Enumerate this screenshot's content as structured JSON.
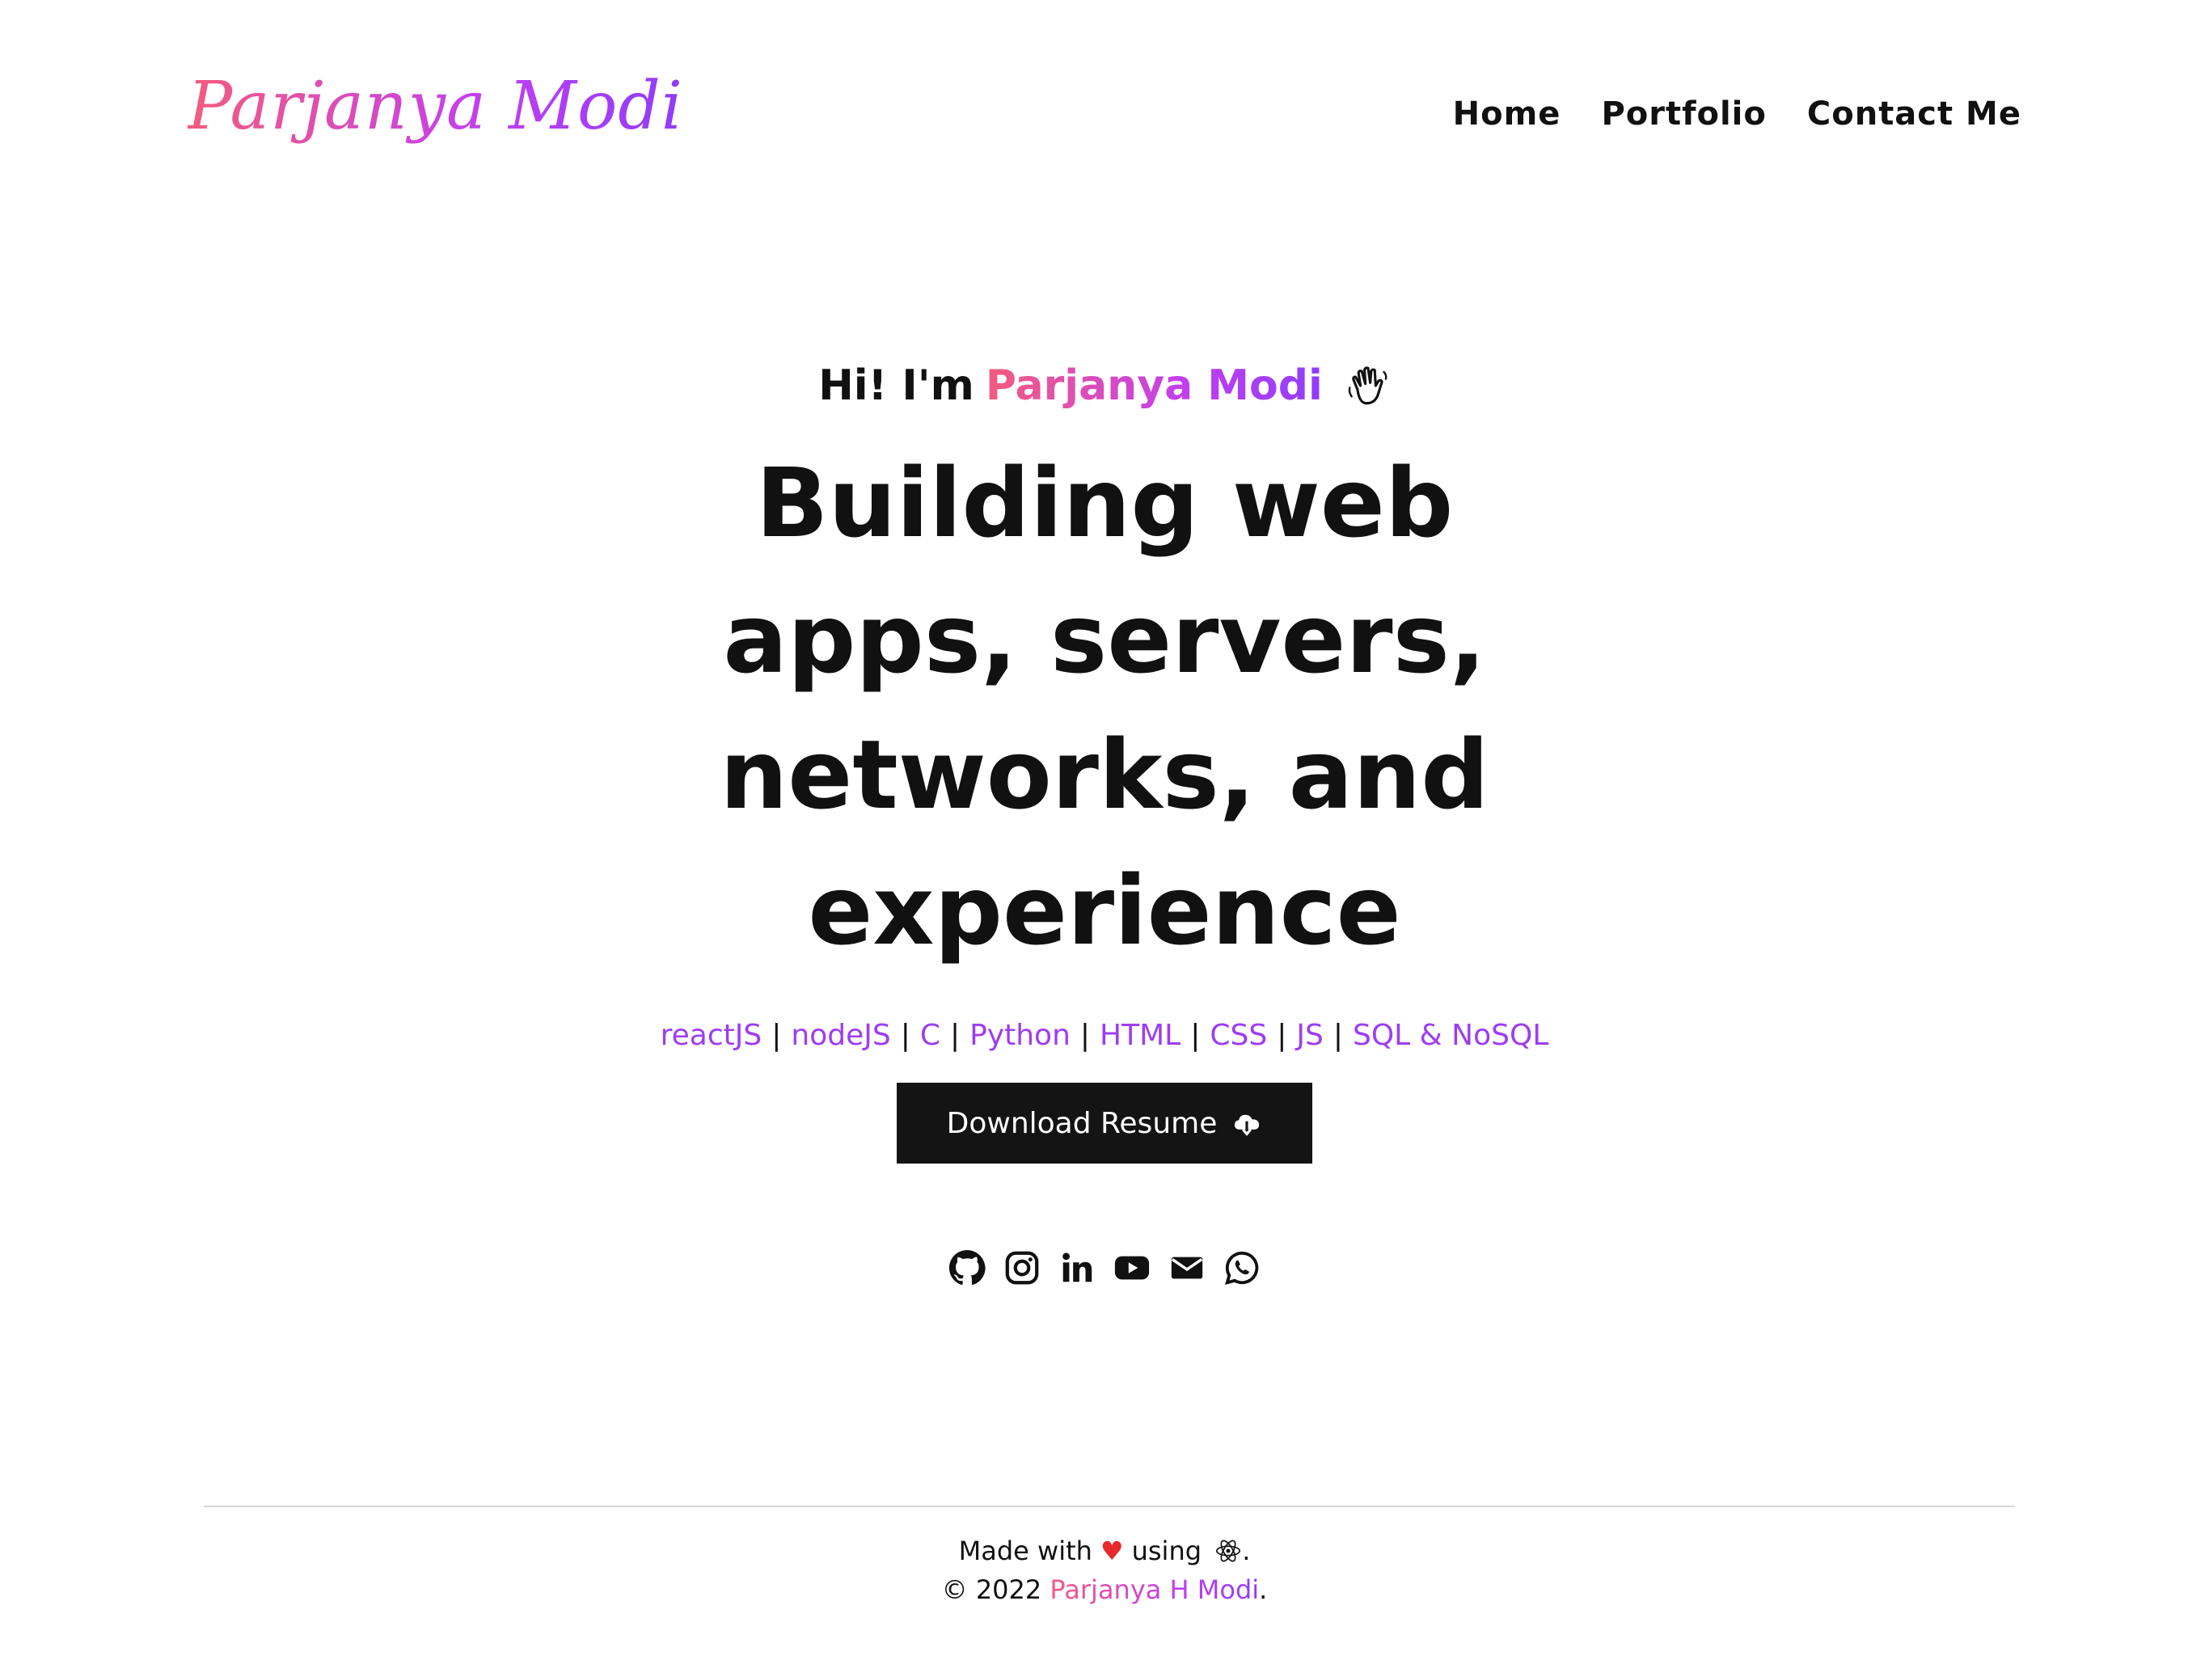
{
  "header": {
    "logo": "Parjanya Modi",
    "nav": [
      "Home",
      "Portfolio",
      "Contact Me"
    ]
  },
  "hero": {
    "greeting_prefix": "Hi! I'm",
    "greeting_name": "Parjanya Modi",
    "headline": "Building web apps, servers, networks, and experience",
    "skills": [
      "reactJS",
      "nodeJS",
      "C",
      "Python",
      "HTML",
      "CSS",
      "JS",
      "SQL & NoSQL"
    ],
    "skill_separator": "|",
    "resume_button": "Download Resume"
  },
  "socials": [
    "github-icon",
    "instagram-icon",
    "linkedin-icon",
    "youtube-icon",
    "mail-icon",
    "whatsapp-icon"
  ],
  "footer": {
    "made_with": "Made with",
    "using": "using",
    "period": ".",
    "copyright_prefix": "© 2022",
    "copyright_name": "Parjanya H Modi",
    "copyright_suffix": "."
  },
  "colors": {
    "gradient_start": "#f45c7e",
    "gradient_end": "#8f3dfb",
    "skill": "#9d3df2",
    "button_bg": "#141414",
    "heart": "#e8282b"
  }
}
